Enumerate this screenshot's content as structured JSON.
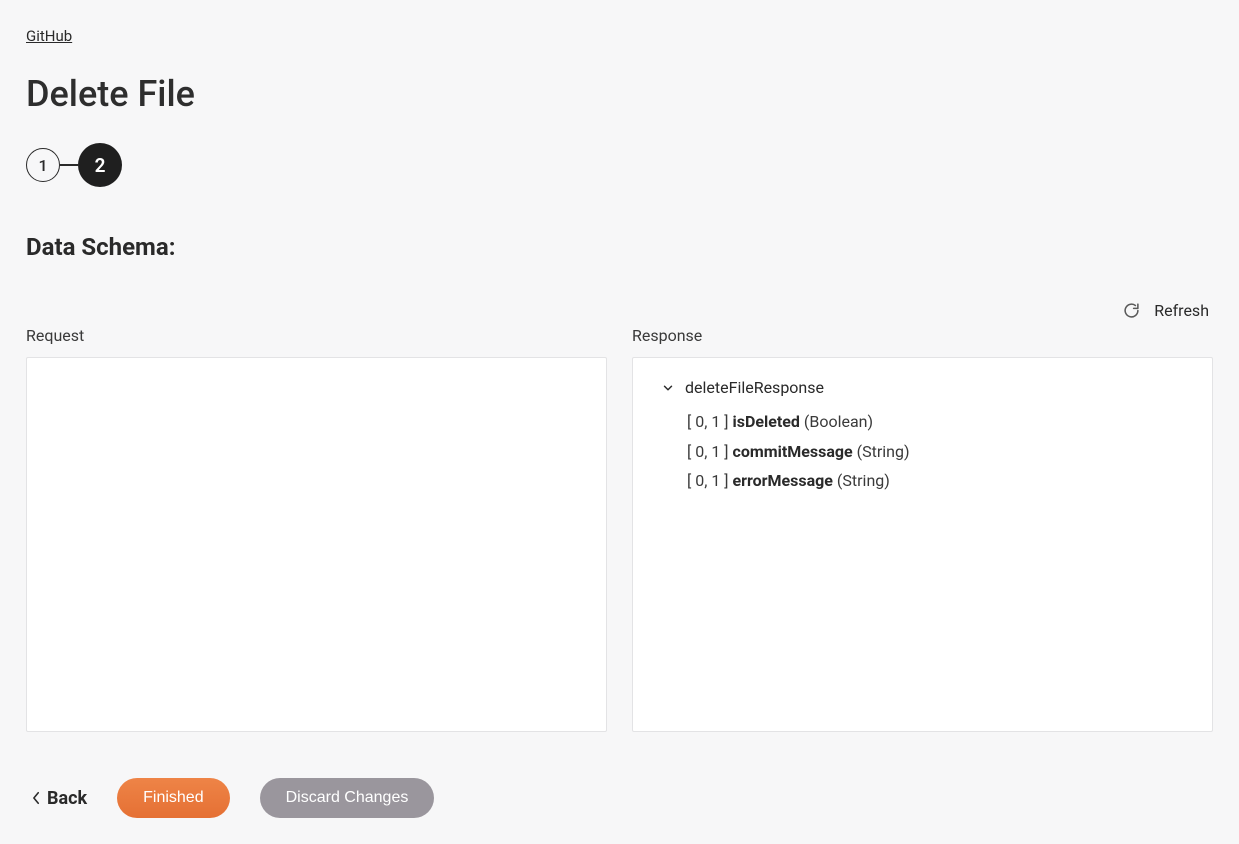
{
  "breadcrumb": {
    "parent": "GitHub"
  },
  "page": {
    "title": "Delete File"
  },
  "stepper": {
    "step1": "1",
    "step2": "2"
  },
  "section": {
    "heading": "Data Schema:"
  },
  "actions": {
    "refresh": "Refresh"
  },
  "panels": {
    "request_label": "Request",
    "response_label": "Response"
  },
  "response_tree": {
    "root": "deleteFileResponse",
    "fields": [
      {
        "cardinality": "[ 0, 1 ]",
        "name": "isDeleted",
        "type": "(Boolean)"
      },
      {
        "cardinality": "[ 0, 1 ]",
        "name": "commitMessage",
        "type": "(String)"
      },
      {
        "cardinality": "[ 0, 1 ]",
        "name": "errorMessage",
        "type": "(String)"
      }
    ]
  },
  "footer": {
    "back": "Back",
    "finished": "Finished",
    "discard": "Discard Changes"
  }
}
